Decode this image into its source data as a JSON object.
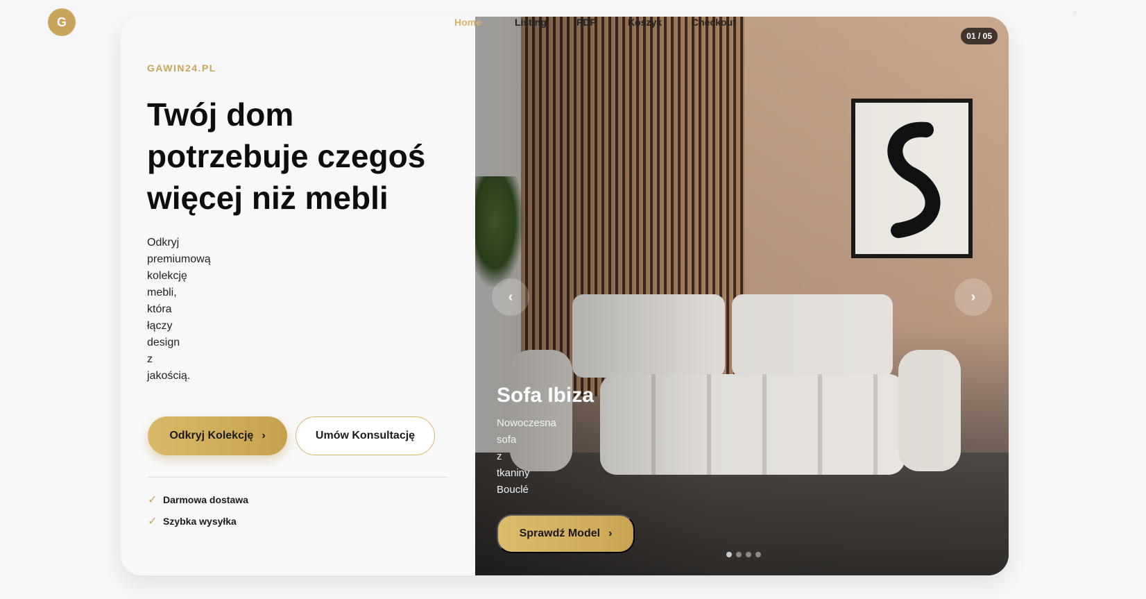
{
  "logo": {
    "letter": "G"
  },
  "nav": {
    "items": [
      {
        "label": "Home",
        "active": true
      },
      {
        "label": "Listing",
        "active": false
      },
      {
        "label": "PDP",
        "active": false
      },
      {
        "label": "Koszyk",
        "active": false
      },
      {
        "label": "Checkout",
        "active": false
      }
    ]
  },
  "hero": {
    "brand": "GAWIN24.PL",
    "headline_lines": [
      "Twój dom",
      "potrzebuje czegoś",
      "więcej niż mebli"
    ],
    "description_words": [
      "Odkryj",
      "premiumową",
      "kolekcję",
      "mebli,",
      "która",
      "łączy",
      "design",
      "z",
      "jakością."
    ],
    "primary_button": "Odkryj Kolekcję",
    "secondary_button": "Umów Konsultację",
    "features": [
      "Darmowa dostawa",
      "Szybka wysyłka"
    ]
  },
  "slider": {
    "counter": "01 / 05",
    "title": "Sofa Ibiza",
    "description_words": [
      "Nowoczesna",
      "sofa",
      "z",
      "tkaniny",
      "Bouclé"
    ],
    "button": "Sprawdź Model",
    "dots_total": 4,
    "active_dot": 0
  },
  "colors": {
    "accent": "#c9a55c",
    "nav_active": "#d7b46a",
    "background": "#f6f6f6"
  },
  "icons": {
    "check": "check-icon",
    "chevron": "chevron-right-icon",
    "prev": "chevron-left-icon",
    "next": "chevron-right-icon"
  }
}
